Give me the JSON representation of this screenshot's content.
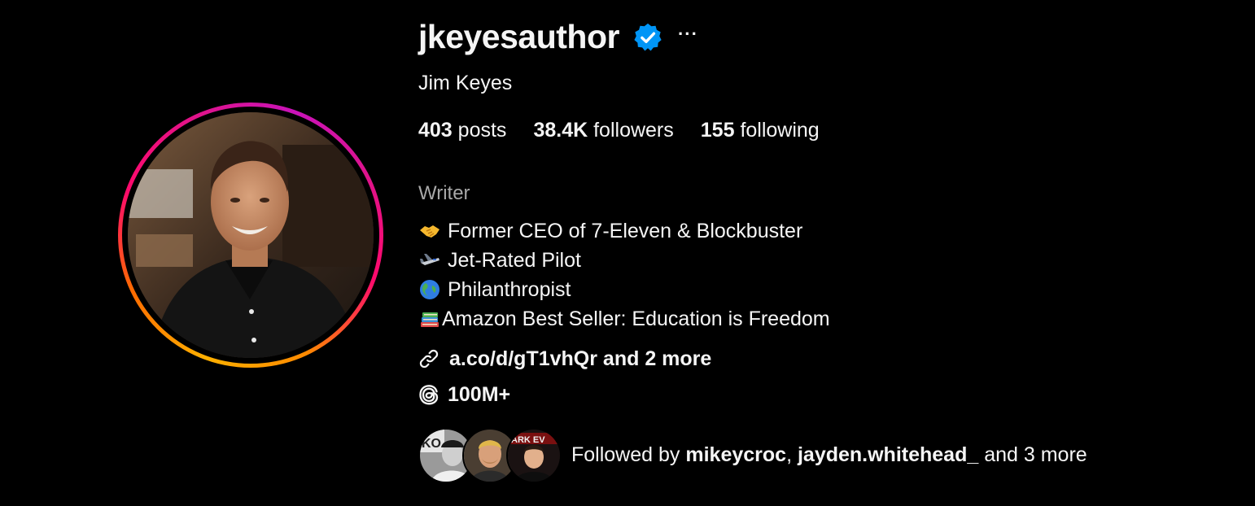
{
  "profile": {
    "username": "jkeyesauthor",
    "full_name": "Jim Keyes",
    "category": "Writer",
    "more_label": "···",
    "icons": {
      "verified": "verified-badge-icon",
      "more": "more-options-icon",
      "link": "link-icon",
      "threads": "threads-icon"
    },
    "accent_color": "#0095f6",
    "ring_colors": [
      "#ffb000",
      "#ff0a6c",
      "#c913b9"
    ]
  },
  "stats": {
    "posts_count": "403",
    "posts_label": "posts",
    "followers_count": "38.4K",
    "followers_label": "followers",
    "following_count": "155",
    "following_label": "following"
  },
  "bio": {
    "lines": [
      {
        "emoji": "handshake",
        "text": "Former CEO of 7-Eleven & Blockbuster"
      },
      {
        "emoji": "airplane",
        "text": "Jet-Rated Pilot"
      },
      {
        "emoji": "globe",
        "text": "Philanthropist"
      },
      {
        "emoji": "books",
        "text": "Amazon Best Seller: Education is Freedom"
      }
    ]
  },
  "link": {
    "text": "a.co/d/gT1vhQr and 2 more"
  },
  "threads": {
    "text": "100M+"
  },
  "followed_by": {
    "prefix": "Followed by ",
    "user1": "mikeycroc",
    "separator": ", ",
    "user2": "jayden.whitehead_",
    "suffix": " and 3 more"
  }
}
